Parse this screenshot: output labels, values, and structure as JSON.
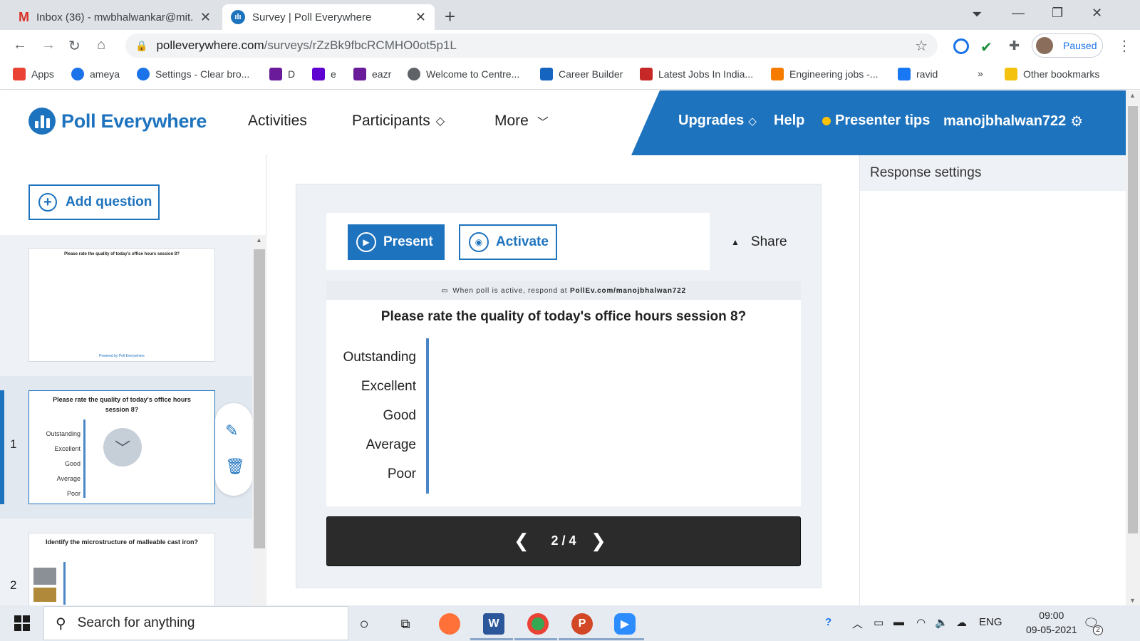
{
  "browser": {
    "tabs": [
      {
        "title": "Inbox (36) - mwbhalwankar@mit.",
        "favicon": "gmail-icon",
        "active": false
      },
      {
        "title": "Survey | Poll Everywhere",
        "favicon": "polleverywhere-icon",
        "active": true
      }
    ],
    "url_host": "polleverywhere.com",
    "url_path": "/surveys/rZzBk9fbcRCMHO0ot5p1L",
    "profile_status": "Paused",
    "bookmarks": [
      {
        "label": "Apps",
        "icon": "apps-grid-icon",
        "color": "#ea4335"
      },
      {
        "label": "ameya",
        "icon": "profile-icon",
        "color": "#1a73e8"
      },
      {
        "label": "Settings - Clear bro...",
        "icon": "gear-icon",
        "color": "#1a73e8"
      },
      {
        "label": "D",
        "icon": "mail-icon",
        "color": "#6a1b9a"
      },
      {
        "label": "e",
        "icon": "yahoo-icon",
        "color": "#5f01d1"
      },
      {
        "label": "eazr",
        "icon": "mail-icon",
        "color": "#6a1b9a"
      },
      {
        "label": "Welcome to Centre...",
        "icon": "globe-icon",
        "color": "#5f6368"
      },
      {
        "label": "Career Builder",
        "icon": "cb-icon",
        "color": "#1565c0"
      },
      {
        "label": "Latest Jobs In India...",
        "icon": "jobs-icon",
        "color": "#c62828"
      },
      {
        "label": "Engineering jobs -...",
        "icon": "c-icon",
        "color": "#f57c00"
      },
      {
        "label": "ravid",
        "icon": "facebook-icon",
        "color": "#1877f2"
      }
    ],
    "more_bookmarks": "»",
    "other_bookmarks": "Other bookmarks"
  },
  "app": {
    "logo": "Poll Everywhere",
    "nav": [
      {
        "label": "Activities"
      },
      {
        "label": "Participants"
      },
      {
        "label": "More"
      }
    ],
    "right_nav": {
      "upgrades": "Upgrades",
      "help": "Help",
      "presenter_tips": "Presenter tips",
      "username": "manojbhalwan722"
    },
    "brand_color": "#1e73be"
  },
  "sidebar": {
    "add_question": "Add question",
    "slides": [
      {
        "number": "",
        "question": "Please rate the quality of today's office hours session 8?",
        "footer": "Powered by Poll Everywhere"
      },
      {
        "number": "1",
        "question": "Please rate the quality of today's office hours session 8?",
        "options": [
          "Outstanding",
          "Excellent",
          "Good",
          "Average",
          "Poor"
        ]
      },
      {
        "number": "2",
        "question": "Identify the microstructure of malleable cast iron?"
      }
    ]
  },
  "main": {
    "present": "Present",
    "activate": "Activate",
    "share": "Share",
    "hint_prefix": "When poll is active, respond at ",
    "hint_url": "PollEv.com/manojbhalwan722",
    "question": "Please rate the quality of today's office hours session 8?",
    "options": [
      "Outstanding",
      "Excellent",
      "Good",
      "Average",
      "Poor"
    ],
    "page": "2 / 4"
  },
  "right_panel": {
    "title": "Response settings"
  },
  "taskbar": {
    "search_placeholder": "Search for anything",
    "language": "ENG",
    "time": "09:00",
    "date": "09-05-2021",
    "notifications": "2"
  }
}
